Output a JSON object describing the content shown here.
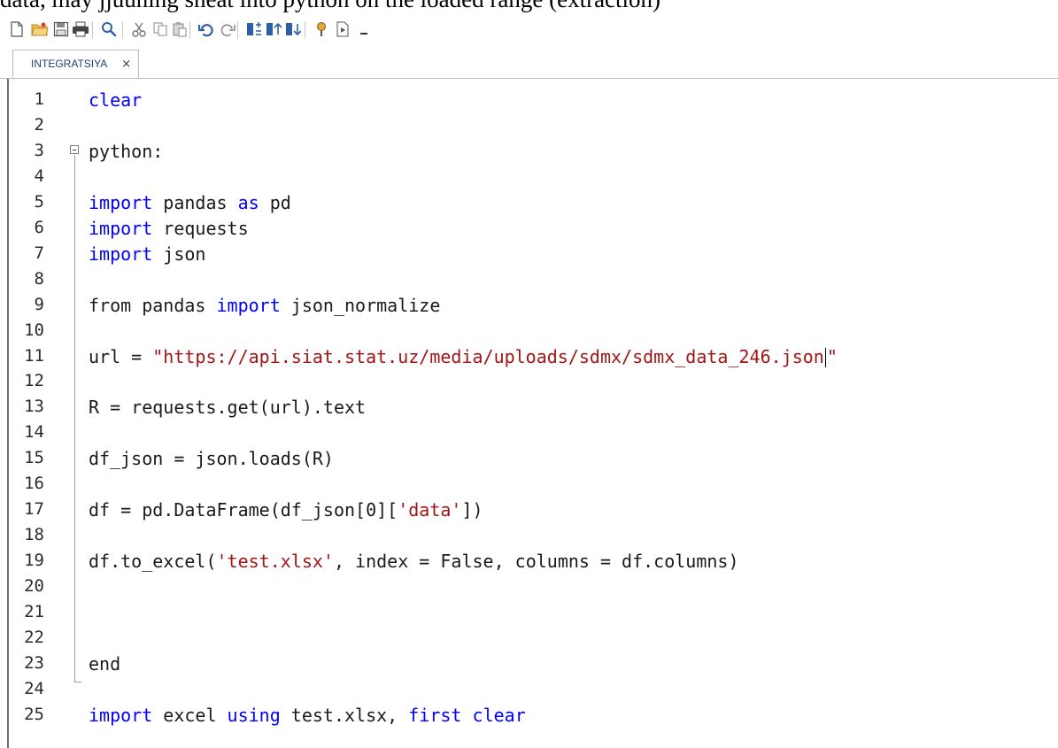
{
  "caption_text": "data, may jjuuning sheat into python on the loaded range (extraction)",
  "colors": {
    "keyword": "#0000ff",
    "string": "#a31515",
    "text": "#1a1a1a",
    "line_number": "#2b2b2b",
    "tab_label": "#1f3f7a"
  },
  "toolbar": {
    "buttons": [
      {
        "name": "new-file-icon"
      },
      {
        "name": "open-folder-icon"
      },
      {
        "name": "save-icon"
      },
      {
        "name": "print-icon"
      },
      {
        "name": "search-icon"
      },
      {
        "name": "cut-icon"
      },
      {
        "name": "copy-icon"
      },
      {
        "name": "paste-icon"
      },
      {
        "name": "undo-icon"
      },
      {
        "name": "redo-icon"
      },
      {
        "name": "bookmark-add-icon"
      },
      {
        "name": "bookmark-prev-icon"
      },
      {
        "name": "bookmark-next-icon"
      },
      {
        "name": "pin-icon"
      },
      {
        "name": "run-icon"
      },
      {
        "name": "dropdown-icon"
      }
    ]
  },
  "tab": {
    "label": "INTEGRATSIYA",
    "close": "×"
  },
  "editor": {
    "lines": [
      {
        "n": "1",
        "tokens": [
          {
            "t": "clear",
            "c": "kw"
          }
        ]
      },
      {
        "n": "2",
        "tokens": []
      },
      {
        "n": "3",
        "tokens": [
          {
            "t": "python:",
            "c": ""
          }
        ]
      },
      {
        "n": "4",
        "tokens": []
      },
      {
        "n": "5",
        "tokens": [
          {
            "t": "import",
            "c": "kw"
          },
          {
            "t": " pandas ",
            "c": ""
          },
          {
            "t": "as",
            "c": "kw"
          },
          {
            "t": " pd",
            "c": ""
          }
        ]
      },
      {
        "n": "6",
        "tokens": [
          {
            "t": "import",
            "c": "kw"
          },
          {
            "t": " requests",
            "c": ""
          }
        ]
      },
      {
        "n": "7",
        "tokens": [
          {
            "t": "import",
            "c": "kw"
          },
          {
            "t": " json",
            "c": ""
          }
        ]
      },
      {
        "n": "8",
        "tokens": []
      },
      {
        "n": "9",
        "tokens": [
          {
            "t": "from pandas ",
            "c": ""
          },
          {
            "t": "import",
            "c": "kw"
          },
          {
            "t": " json_normalize",
            "c": ""
          }
        ]
      },
      {
        "n": "10",
        "tokens": []
      },
      {
        "n": "11",
        "tokens": [
          {
            "t": "url = ",
            "c": ""
          },
          {
            "t": "\"https://api.siat.stat.uz/media/uploads/sdmx/sdmx_data_246.json",
            "c": "str"
          },
          {
            "t": "",
            "c": "caret"
          },
          {
            "t": "\"",
            "c": "str"
          }
        ]
      },
      {
        "n": "12",
        "tokens": []
      },
      {
        "n": "13",
        "tokens": [
          {
            "t": "R = requests.get(url).text",
            "c": ""
          }
        ]
      },
      {
        "n": "14",
        "tokens": []
      },
      {
        "n": "15",
        "tokens": [
          {
            "t": "df_json = json.loads(R)",
            "c": ""
          }
        ]
      },
      {
        "n": "16",
        "tokens": []
      },
      {
        "n": "17",
        "tokens": [
          {
            "t": "df = pd.DataFrame(df_json[0][",
            "c": ""
          },
          {
            "t": "'data'",
            "c": "str"
          },
          {
            "t": "])",
            "c": ""
          }
        ]
      },
      {
        "n": "18",
        "tokens": []
      },
      {
        "n": "19",
        "tokens": [
          {
            "t": "df.to_excel(",
            "c": ""
          },
          {
            "t": "'test.xlsx'",
            "c": "str"
          },
          {
            "t": ", index = False, columns = df.columns)",
            "c": ""
          }
        ]
      },
      {
        "n": "20",
        "tokens": []
      },
      {
        "n": "21",
        "tokens": []
      },
      {
        "n": "22",
        "tokens": []
      },
      {
        "n": "23",
        "tokens": [
          {
            "t": "end",
            "c": ""
          }
        ]
      },
      {
        "n": "24",
        "tokens": []
      },
      {
        "n": "25",
        "tokens": [
          {
            "t": "import",
            "c": "kw"
          },
          {
            "t": " excel ",
            "c": ""
          },
          {
            "t": "using",
            "c": "kw"
          },
          {
            "t": " test.xlsx, ",
            "c": ""
          },
          {
            "t": "first",
            "c": "kw"
          },
          {
            "t": " ",
            "c": ""
          },
          {
            "t": "clear",
            "c": "kw"
          }
        ]
      }
    ]
  }
}
